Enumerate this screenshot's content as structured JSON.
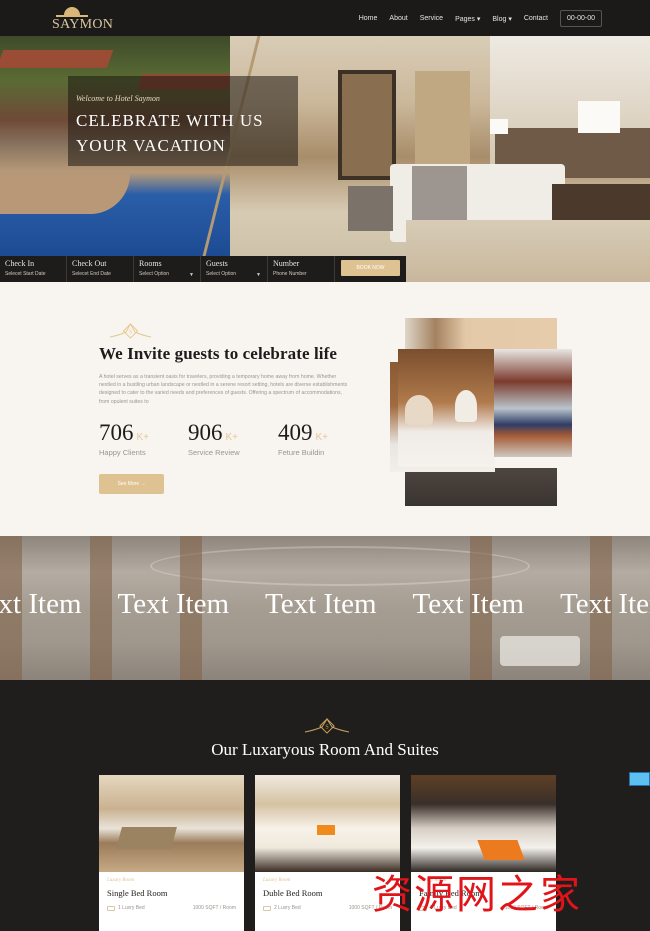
{
  "header": {
    "logo_text": "SAYMON",
    "nav": [
      {
        "label": "Home"
      },
      {
        "label": "About"
      },
      {
        "label": "Service"
      },
      {
        "label": "Pages ▾"
      },
      {
        "label": "Blog ▾"
      },
      {
        "label": "Contact"
      }
    ],
    "phone": "00-00-00"
  },
  "hero": {
    "subtitle": "Welcome to Hotel Saymon",
    "title_line1": "CELEBRATE WITH US",
    "title_line2": "YOUR VACATION"
  },
  "booking": {
    "fields": [
      {
        "label": "Check In",
        "value": "Selecet Start Date"
      },
      {
        "label": "Check Out",
        "value": "Selecet End Date"
      },
      {
        "label": "Rooms",
        "value": "Select Option",
        "dropdown": true
      },
      {
        "label": "Guests",
        "value": "Select Option",
        "dropdown": true
      },
      {
        "label": "Number",
        "value": "Phone Number"
      }
    ],
    "button": "BOOK NOW"
  },
  "about": {
    "title": "We Invite guests to celebrate life",
    "text": "A hotel serves as a transient oasis for travelers, providing a temporary home away from home. Whether nestled in a bustling urban landscape or nestled in a serene resort setting, hotels are diverse establishments designed to cater to the varied needs and preferences of guests. Offering a spectrum of accommodations, from opulent suites to",
    "stats": [
      {
        "value": "706",
        "suffix": "K+",
        "label": "Happy Clients"
      },
      {
        "value": "906",
        "suffix": "K+",
        "label": "Service Review"
      },
      {
        "value": "409",
        "suffix": "K+",
        "label": "Feture Buildin"
      }
    ],
    "button": "See More →"
  },
  "marquee": {
    "items": [
      "Text Item",
      "Text Item",
      "Text Item",
      "Text Item",
      "Text Item"
    ]
  },
  "rooms": {
    "title": "Our Luxaryous Room And Suites",
    "cards": [
      {
        "tag": "Luxury Room",
        "name": "Single Bed Room",
        "beds": "1 Luxry Bed",
        "size": "1000 SQFT / Room"
      },
      {
        "tag": "Luxury Room",
        "name": "Duble Bed Room",
        "beds": "2 Luxry Bed",
        "size": "1000 SQFT / Room"
      },
      {
        "tag": "Luxury Room",
        "name": "Family Bed Room",
        "beds": "3 Luxry Bed",
        "size": "1000 SQFT / Room"
      }
    ]
  },
  "watermark": "资源网之家",
  "colors": {
    "accent": "#dfc291",
    "dark": "#1f1e1d",
    "cream": "#f8f5f1"
  }
}
